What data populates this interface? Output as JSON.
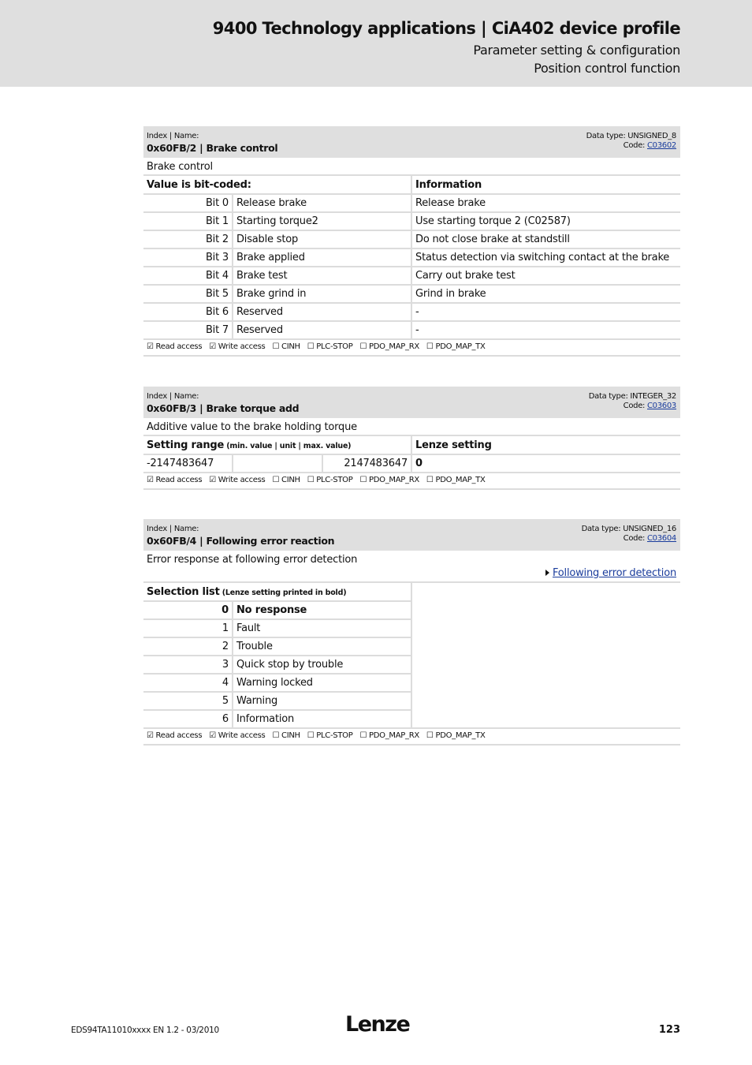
{
  "header": {
    "title": "9400 Technology applications | CiA402 device profile",
    "subtitle1": "Parameter setting & configuration",
    "subtitle2": "Position control function"
  },
  "access_flags": [
    {
      "checked": true,
      "label": "Read access"
    },
    {
      "checked": true,
      "label": "Write access"
    },
    {
      "checked": false,
      "label": "CINH"
    },
    {
      "checked": false,
      "label": "PLC-STOP"
    },
    {
      "checked": false,
      "label": "PDO_MAP_RX"
    },
    {
      "checked": false,
      "label": "PDO_MAP_TX"
    }
  ],
  "access_text": {
    "read": "☑ Read access",
    "write": "☑ Write access",
    "cinh": "☐ CINH",
    "plcstop": "☐ PLC-STOP",
    "rx": "☐ PDO_MAP_RX",
    "tx": "☐ PDO_MAP_TX"
  },
  "params": [
    {
      "index_label": "Index | Name:",
      "name": "0x60FB/2 | Brake control",
      "data_type": "Data type: UNSIGNED_8",
      "code_label": "Code: ",
      "code": "C03602",
      "description": "Brake control",
      "col1_header": "Value is bit-coded:",
      "col2_header": "Information",
      "bits": [
        {
          "bit": "Bit 0",
          "name": "Release brake",
          "info": "Release brake"
        },
        {
          "bit": "Bit 1",
          "name": "Starting torque2",
          "info": "Use starting torque 2 (C02587)"
        },
        {
          "bit": "Bit 2",
          "name": "Disable stop",
          "info": "Do not close brake at standstill"
        },
        {
          "bit": "Bit 3",
          "name": "Brake applied",
          "info": "Status detection via switching contact at the brake"
        },
        {
          "bit": "Bit 4",
          "name": "Brake test",
          "info": "Carry out brake test"
        },
        {
          "bit": "Bit 5",
          "name": "Brake grind in",
          "info": "Grind in brake"
        },
        {
          "bit": "Bit 6",
          "name": "Reserved",
          "info": "-"
        },
        {
          "bit": "Bit 7",
          "name": "Reserved",
          "info": "-"
        }
      ]
    },
    {
      "index_label": "Index | Name:",
      "name": "0x60FB/3 | Brake torque add",
      "data_type": "Data type: INTEGER_32",
      "code_label": "Code: ",
      "code": "C03603",
      "description": "Additive value to the brake holding torque",
      "range_header": "Setting range",
      "range_hint": " (min. value | unit | max. value)",
      "lenze_header": "Lenze setting",
      "min": "-2147483647",
      "unit": "",
      "max": "2147483647",
      "lenze_value": "0"
    },
    {
      "index_label": "Index | Name:",
      "name": "0x60FB/4 | Following error reaction",
      "data_type": "Data type: UNSIGNED_16",
      "code_label": "Code: ",
      "code": "C03604",
      "description": "Error response at following error detection",
      "xref": "Following error detection",
      "list_header": "Selection list",
      "list_hint": " (Lenze setting printed in bold)",
      "options": [
        {
          "value": "0",
          "label": "No response",
          "default": true
        },
        {
          "value": "1",
          "label": "Fault"
        },
        {
          "value": "2",
          "label": "Trouble"
        },
        {
          "value": "3",
          "label": "Quick stop by trouble"
        },
        {
          "value": "4",
          "label": "Warning locked"
        },
        {
          "value": "5",
          "label": "Warning"
        },
        {
          "value": "6",
          "label": "Information"
        }
      ]
    }
  ],
  "footer": {
    "doc_id": "EDS94TA11010xxxx EN 1.2 - 03/2010",
    "logo": "Lenze",
    "page": "123"
  }
}
